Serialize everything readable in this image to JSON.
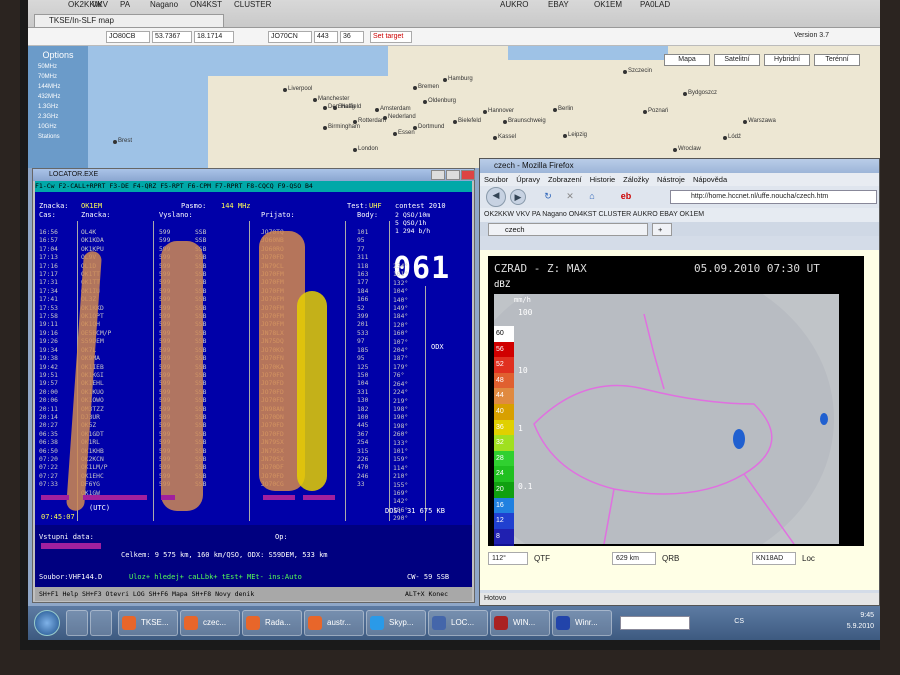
{
  "topbar": {
    "tab_label": "TKSE/In-SLF map",
    "bookmarks": [
      "OK2KKW",
      "VKV",
      "PA",
      "Nagano",
      "ON4KST",
      "CLUSTER",
      "AUKRO",
      "EBAY",
      "OK1EM",
      "PA0LAD"
    ]
  },
  "map": {
    "fields": [
      "JO80CB",
      "53.7367",
      "18.1714",
      "JO70CN",
      "443",
      "36"
    ],
    "set_target": "Set target",
    "version": "Version 3.7",
    "options_title": "Options",
    "options": [
      "50MHz",
      "70MHz",
      "144MHz",
      "432MHz",
      "1.3GHz",
      "2.3GHz",
      "10GHz",
      "Stations"
    ],
    "buttons": [
      "Mapa",
      "Satelitní",
      "Hybridní",
      "Terénní"
    ],
    "cities": [
      "Liverpool",
      "Manchester",
      "Sheffield",
      "Birmingham",
      "London",
      "Den Haag",
      "Rotterdam",
      "Amsterdam",
      "Nederland",
      "Hamburg",
      "Bremen",
      "Berlin",
      "Hannover",
      "Bielefeld",
      "Dortmund",
      "Braunschweig",
      "Kassel",
      "Leipzig",
      "Szczecin",
      "Poznań",
      "Bydgoszcz",
      "Warszawa",
      "Lódź",
      "Wroclaw",
      "Oldenburg",
      "Brest",
      "Essen"
    ]
  },
  "locator": {
    "title": "LOCATOR.EXE",
    "fkeys": "F1-Cw  F2-CALL+RPRT  F3-DE   F4-QRZ   F5-RPT   F6-CPM   F7-RPRT   F8-CQCQ F9-QSO B4",
    "znacka_label": "Znacka:",
    "znacka": "OK1EM",
    "pasmo_label": "Pasmo:",
    "pasmo": "144 MHz",
    "test_label": "Test:",
    "test": "UHF",
    "contest": "contest 2010",
    "headers": [
      "Cas:",
      "Znacka:",
      "Vyslano:",
      "Prijato:",
      "Body:"
    ],
    "times": [
      "16:56",
      "16:57",
      "17:04",
      "17:13",
      "17:16",
      "17:17",
      "17:31",
      "17:34",
      "17:41",
      "17:53",
      "17:58",
      "19:11",
      "19:16",
      "19:26",
      "19:34",
      "19:38",
      "19:42",
      "19:51",
      "19:57",
      "20:00",
      "20:06",
      "20:11",
      "20:14",
      "20:27",
      "06:35",
      "06:38",
      "06:50",
      "07:20",
      "07:22",
      "07:27",
      "07:33"
    ],
    "calls": [
      "OL4K",
      "OK1KDA",
      "OK1KPU",
      "OL9V",
      "OL1D",
      "OK1TT",
      "OK1TT",
      "OK1IU",
      "OL3Z",
      "OK1KKD",
      "OK1OPT",
      "OK1QH",
      "OE5BCM/P",
      "S59DEM",
      "OK7L",
      "OK9MA",
      "OK1IEB",
      "OK1KGI",
      "OK1EHL",
      "OK1KUO",
      "OK1OWO",
      "OM3TZZ",
      "DJ3UR",
      "OK5Z",
      "OK1GDT",
      "OK1RL",
      "OK1KHB",
      "OK2KCN",
      "OK1LM/P",
      "OK1EHC",
      "DF6YG",
      "OK1GW"
    ],
    "sent_prefix": [
      "599",
      "599",
      "599",
      "599",
      "599",
      "599",
      "599",
      "599",
      "599",
      "599",
      "599",
      "599",
      "599",
      "599",
      "599",
      "599",
      "599",
      "599",
      "599",
      "599",
      "599",
      "599",
      "599",
      "599",
      "599",
      "599",
      "599",
      "599",
      "599",
      "599",
      "599"
    ],
    "sent_mode": [
      "SSB",
      "SSB",
      "SSB",
      "SSB",
      "SSB",
      "SSB",
      "SSB",
      "SSB",
      "SSB",
      "SSB",
      "SSB",
      "SSB",
      "SSB",
      "SSB",
      "SSB",
      "SSB",
      "SSB",
      "SSB",
      "SSB",
      "SSB",
      "SSB",
      "SSB",
      "SSB",
      "SSB",
      "SSB",
      "SSB",
      "SSB",
      "SSB",
      "SSB",
      "SSB",
      "SSB"
    ],
    "rcvd_loc": [
      "JO70TQ",
      "JO60NB",
      "JO60RO",
      "JO70FD",
      "JN79CL",
      "JO70FM",
      "JO70FM",
      "JO70FM",
      "JO70FM",
      "JO70FM",
      "JO70FM",
      "JO70FM",
      "JN78LX",
      "JN75DQ",
      "JO70KO",
      "JO70FN",
      "JO70KA",
      "JO70FD",
      "JO70FD",
      "JO70FD",
      "JO70FD",
      "JN98AN",
      "JO70DN",
      "JO70FD",
      "JO70FD",
      "JN79SX",
      "JN79SX",
      "JN79SX",
      "JO70DF",
      "JO70FD",
      "JO70CG"
    ],
    "points": [
      "101",
      "95",
      "77",
      "311",
      "118",
      "163",
      "177",
      "184",
      "166",
      "52",
      "399",
      "201",
      "533",
      "97",
      "185",
      "95",
      "125",
      "150",
      "104",
      "331",
      "130",
      "182",
      "100",
      "445",
      "367",
      "254",
      "315",
      "226",
      "470",
      "246",
      "33"
    ],
    "azimuth": [
      "234°",
      "101°",
      "132°",
      "104°",
      "140°",
      "149°",
      "184°",
      "120°",
      "160°",
      "107°",
      "204°",
      "187°",
      "179°",
      "76°",
      "264°",
      "224°",
      "219°",
      "198°",
      "190°",
      "198°",
      "260°",
      "133°",
      "101°",
      "159°",
      "114°",
      "210°",
      "155°",
      "169°",
      "142°",
      "186°",
      "290°"
    ],
    "qso_rate1": "2 QSO/10m",
    "qso_rate2": "5 QSO/1h",
    "rate_kmh": "1 294 b/h",
    "big_count": "061",
    "odx": "ODX",
    "utc_label": "(UTC)",
    "time_now": "07:45:07",
    "dos_label": "DOS:",
    "dos_value": "31 675 KB",
    "input_label": "Vstupni data:",
    "op_label": "Op:",
    "totals": "Celkem: 9 575 km, 160 km/QSO, ODX: S59DEM, 533 km",
    "file_label": "Soubor:VHF144.D",
    "status_cmds": "Uloz+  hledej+  caLLbk+  tEst+   MEt-  ins:Auto",
    "mode_right": "CW-   59 SSB",
    "help": "SH+F1 Help  SH+F3 Otevri LOG  SH+F6 Mapa  SH+F8 Novy denik",
    "alt_x": "ALT+X Konec"
  },
  "firefox": {
    "title": "czech - Mozilla Firefox",
    "menu": [
      "Soubor",
      "Úpravy",
      "Zobrazení",
      "Historie",
      "Záložky",
      "Nástroje",
      "Nápověda"
    ],
    "url": "http://home.hccnet.nl/uffe.noucha/czech.htm",
    "bookmarks": "OK2KKW   VKV   PA   Nagano   ON4KST   CLUSTER   AUKRO   EBAY   OK1EM",
    "tab_label": "czech",
    "radar_title": "CZRAD - Z: MAX",
    "radar_date": "05.09.2010 07:30 UT",
    "radar_unit": "dBZ",
    "mmh": "mm/h",
    "scale_values": [
      "60",
      "56",
      "52",
      "48",
      "44",
      "40",
      "36",
      "32",
      "28",
      "24",
      "20",
      "16",
      "12",
      "8",
      "4"
    ],
    "scale_colors": [
      "#ffffff",
      "#d00000",
      "#e03020",
      "#e06030",
      "#e08a40",
      "#d8a000",
      "#e0d000",
      "#a0e020",
      "#30d030",
      "#20c020",
      "#10a010",
      "#2080e0",
      "#2040d0",
      "#2020b0",
      "#101090"
    ],
    "mmh_values": [
      "100",
      "10",
      "1",
      "0.1"
    ],
    "qtf_value": "112°",
    "qtf_label": "QTF",
    "qrb_value": "629 km",
    "qrb_label": "QRB",
    "loc_value": "KN18AD",
    "loc_label": "Loc",
    "status": "Hotovo"
  },
  "taskbar": {
    "items": [
      "TKSE...",
      "czec...",
      "Rada...",
      "austr...",
      "Skyp...",
      "LOC...",
      "WIN...",
      "Winr..."
    ],
    "lang": "CS",
    "time": "9:45",
    "date": "5.9.2010"
  }
}
